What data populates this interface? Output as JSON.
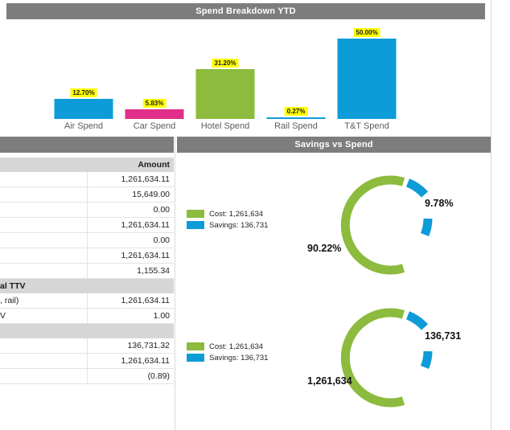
{
  "spend_panel": {
    "title": "Spend Breakdown YTD"
  },
  "savings_panel": {
    "title": "Savings vs Spend"
  },
  "table": {
    "amount_header": "Amount",
    "rows": [
      {
        "label": "",
        "amount": "1,261,634.11",
        "section": false
      },
      {
        "label": "",
        "amount": "15,649.00",
        "section": false
      },
      {
        "label": "",
        "amount": "0.00",
        "section": false
      },
      {
        "label": "",
        "amount": "1,261,634.11",
        "section": false
      },
      {
        "label": "",
        "amount": "0.00",
        "section": false
      },
      {
        "label": "",
        "amount": "1,261,634.11",
        "section": false
      },
      {
        "label": "",
        "amount": "1,155.34",
        "section": false
      },
      {
        "label": "al TTV",
        "amount": "",
        "section": true
      },
      {
        "label": ", rail)",
        "amount": "1,261,634.11",
        "section": false
      },
      {
        "label": "V",
        "amount": "1.00",
        "section": false
      },
      {
        "label": "",
        "amount": "",
        "section": true
      },
      {
        "label": "",
        "amount": "136,731.32",
        "section": false
      },
      {
        "label": "",
        "amount": "1,261,634.11",
        "section": false
      },
      {
        "label": "",
        "amount": "(0.89)",
        "section": false
      }
    ]
  },
  "chart_data": [
    {
      "type": "bar",
      "title": "Spend Breakdown YTD",
      "xlabel": "",
      "ylabel": "",
      "categories": [
        "Air Spend",
        "Car Spend",
        "Hotel Spend",
        "Rail Spend",
        "T&T Spend"
      ],
      "values": [
        12.7,
        5.83,
        31.2,
        0.27,
        50.0
      ],
      "value_labels": [
        "12.70%",
        "5.83%",
        "31.20%",
        "0.27%",
        "50.00%"
      ],
      "colors": [
        "#0e9cd8",
        "#e02e8a",
        "#8cbb3d",
        "#0e9cd8",
        "#0e9cd8"
      ],
      "ylim": [
        0,
        55
      ],
      "grid": false,
      "legend": "none"
    },
    {
      "type": "pie",
      "title": "Savings vs Spend",
      "variant": "donut",
      "labels": [
        "Cost",
        "Savings"
      ],
      "values": [
        90.22,
        9.78
      ],
      "slice_labels": [
        "90.22%",
        "9.78%"
      ],
      "legend_entries": [
        "Cost: 1,261,634",
        "Savings: 136,731"
      ],
      "colors": [
        "#8cbb3d",
        "#0e9cd8"
      ],
      "legend_position": "left"
    },
    {
      "type": "pie",
      "title": "Savings vs Spend",
      "variant": "donut",
      "labels": [
        "Cost",
        "Savings"
      ],
      "values": [
        1261634,
        136731
      ],
      "slice_labels": [
        "1,261,634",
        "136,731"
      ],
      "legend_entries": [
        "Cost: 1,261,634",
        "Savings: 136,731"
      ],
      "colors": [
        "#8cbb3d",
        "#0e9cd8"
      ],
      "legend_position": "left"
    }
  ],
  "colors": {
    "header_bar": "#7d7d7d",
    "blue": "#0e9cd8",
    "green": "#8cbb3d",
    "pink": "#e02e8a",
    "highlight": "#ffff00"
  }
}
